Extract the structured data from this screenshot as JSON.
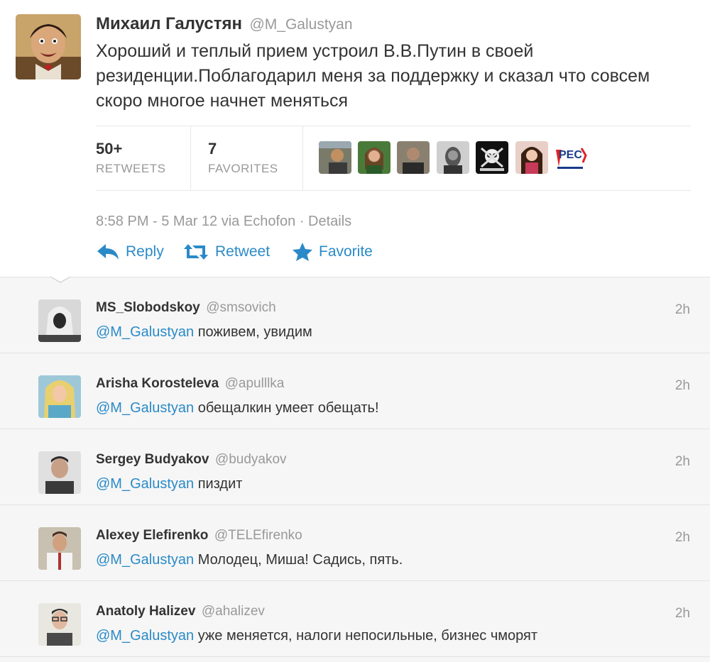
{
  "main_tweet": {
    "author_name": "Михаил Галустян",
    "author_handle": "@M_Galustyan",
    "text": "Хороший и теплый прием устроил В.В.Путин в своей резиденции.Поблагодарил меня за поддержку и сказал что совсем скоро многое начнет меняться",
    "retweets_count": "50+",
    "retweets_label": "RETWEETS",
    "favorites_count": "7",
    "favorites_label": "FAVORITES",
    "favoriters_logo_text": "PEC",
    "timestamp": "8:58 PM - 5 Mar 12 via Echofon",
    "separator": "·",
    "details_label": "Details",
    "actions": {
      "reply": "Reply",
      "retweet": "Retweet",
      "favorite": "Favorite"
    }
  },
  "replies": [
    {
      "name": "MS_Slobodskoy",
      "handle": "@smsovich",
      "mention": "@M_Galustyan",
      "text": "поживем, увидим",
      "time": "2h"
    },
    {
      "name": "Arisha Korosteleva",
      "handle": "@apulllka",
      "mention": "@M_Galustyan",
      "text": "обещалкин умеет обещать!",
      "time": "2h"
    },
    {
      "name": "Sergey Budyakov",
      "handle": "@budyakov",
      "mention": "@M_Galustyan",
      "text": "пиздит",
      "time": "2h"
    },
    {
      "name": "Alexey Elefirenko",
      "handle": "@TELEfirenko",
      "mention": "@M_Galustyan",
      "text": "Молодец, Миша! Садись, пять.",
      "time": "2h"
    },
    {
      "name": "Anatoly Halizev",
      "handle": "@ahalizev",
      "mention": "@M_Galustyan",
      "text": "уже меняется, налоги непосильные, бизнес чморят",
      "time": "2h"
    }
  ],
  "colors": {
    "link": "#2a8ac8",
    "muted": "#999999",
    "text": "#333333",
    "replies_bg": "#f6f6f6"
  }
}
